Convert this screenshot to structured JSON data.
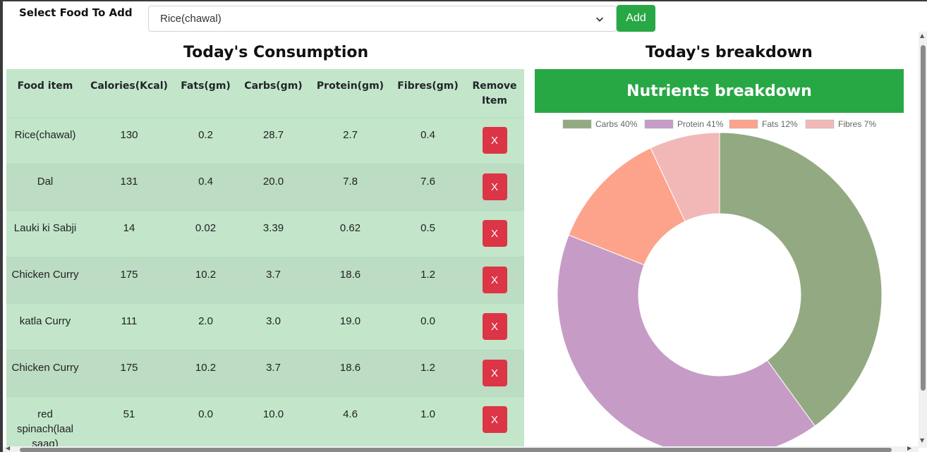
{
  "top": {
    "select_label": "Select Food To Add",
    "selected_food": "Rice(chawal)",
    "add_label": "Add"
  },
  "consumption": {
    "title": "Today's Consumption",
    "headers": [
      "Food item",
      "Calories(Kcal)",
      "Fats(gm)",
      "Carbs(gm)",
      "Protein(gm)",
      "Fibres(gm)",
      "Remove Item"
    ],
    "remove_label": "X",
    "rows": [
      [
        "Rice(chawal)",
        "130",
        "0.2",
        "28.7",
        "2.7",
        "0.4"
      ],
      [
        "Dal",
        "131",
        "0.4",
        "20.0",
        "7.8",
        "7.6"
      ],
      [
        "Lauki ki Sabji",
        "14",
        "0.02",
        "3.39",
        "0.62",
        "0.5"
      ],
      [
        "Chicken Curry",
        "175",
        "10.2",
        "3.7",
        "18.6",
        "1.2"
      ],
      [
        "katla Curry",
        "111",
        "2.0",
        "3.0",
        "19.0",
        "0.0"
      ],
      [
        "Chicken Curry",
        "175",
        "10.2",
        "3.7",
        "18.6",
        "1.2"
      ],
      [
        "red spinach(laal saag)",
        "51",
        "0.0",
        "10.0",
        "4.6",
        "1.0"
      ]
    ]
  },
  "breakdown": {
    "title": "Today's breakdown",
    "chart_title": "Nutrients breakdown"
  },
  "chart_data": {
    "type": "pie",
    "donut": true,
    "labels": [
      "Carbs 40%",
      "Protein 41%",
      "Fats 12%",
      "Fibres 7%"
    ],
    "values": [
      40,
      41,
      12,
      7
    ],
    "colors": [
      "#93a982",
      "#c69cc6",
      "#fda38c",
      "#f2b8b8"
    ],
    "legend_position": "top"
  }
}
